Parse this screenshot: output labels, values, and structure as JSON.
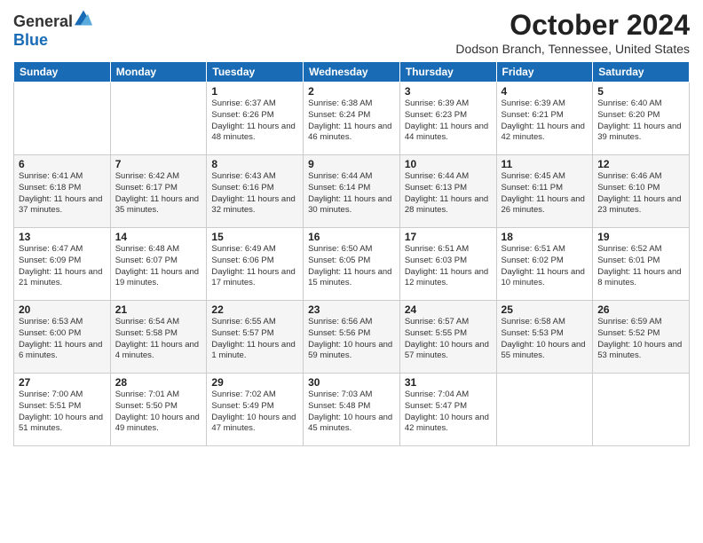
{
  "logo": {
    "general": "General",
    "blue": "Blue"
  },
  "title": "October 2024",
  "subtitle": "Dodson Branch, Tennessee, United States",
  "days_header": [
    "Sunday",
    "Monday",
    "Tuesday",
    "Wednesday",
    "Thursday",
    "Friday",
    "Saturday"
  ],
  "weeks": [
    [
      {
        "day": "",
        "detail": ""
      },
      {
        "day": "",
        "detail": ""
      },
      {
        "day": "1",
        "detail": "Sunrise: 6:37 AM\nSunset: 6:26 PM\nDaylight: 11 hours and 48 minutes."
      },
      {
        "day": "2",
        "detail": "Sunrise: 6:38 AM\nSunset: 6:24 PM\nDaylight: 11 hours and 46 minutes."
      },
      {
        "day": "3",
        "detail": "Sunrise: 6:39 AM\nSunset: 6:23 PM\nDaylight: 11 hours and 44 minutes."
      },
      {
        "day": "4",
        "detail": "Sunrise: 6:39 AM\nSunset: 6:21 PM\nDaylight: 11 hours and 42 minutes."
      },
      {
        "day": "5",
        "detail": "Sunrise: 6:40 AM\nSunset: 6:20 PM\nDaylight: 11 hours and 39 minutes."
      }
    ],
    [
      {
        "day": "6",
        "detail": "Sunrise: 6:41 AM\nSunset: 6:18 PM\nDaylight: 11 hours and 37 minutes."
      },
      {
        "day": "7",
        "detail": "Sunrise: 6:42 AM\nSunset: 6:17 PM\nDaylight: 11 hours and 35 minutes."
      },
      {
        "day": "8",
        "detail": "Sunrise: 6:43 AM\nSunset: 6:16 PM\nDaylight: 11 hours and 32 minutes."
      },
      {
        "day": "9",
        "detail": "Sunrise: 6:44 AM\nSunset: 6:14 PM\nDaylight: 11 hours and 30 minutes."
      },
      {
        "day": "10",
        "detail": "Sunrise: 6:44 AM\nSunset: 6:13 PM\nDaylight: 11 hours and 28 minutes."
      },
      {
        "day": "11",
        "detail": "Sunrise: 6:45 AM\nSunset: 6:11 PM\nDaylight: 11 hours and 26 minutes."
      },
      {
        "day": "12",
        "detail": "Sunrise: 6:46 AM\nSunset: 6:10 PM\nDaylight: 11 hours and 23 minutes."
      }
    ],
    [
      {
        "day": "13",
        "detail": "Sunrise: 6:47 AM\nSunset: 6:09 PM\nDaylight: 11 hours and 21 minutes."
      },
      {
        "day": "14",
        "detail": "Sunrise: 6:48 AM\nSunset: 6:07 PM\nDaylight: 11 hours and 19 minutes."
      },
      {
        "day": "15",
        "detail": "Sunrise: 6:49 AM\nSunset: 6:06 PM\nDaylight: 11 hours and 17 minutes."
      },
      {
        "day": "16",
        "detail": "Sunrise: 6:50 AM\nSunset: 6:05 PM\nDaylight: 11 hours and 15 minutes."
      },
      {
        "day": "17",
        "detail": "Sunrise: 6:51 AM\nSunset: 6:03 PM\nDaylight: 11 hours and 12 minutes."
      },
      {
        "day": "18",
        "detail": "Sunrise: 6:51 AM\nSunset: 6:02 PM\nDaylight: 11 hours and 10 minutes."
      },
      {
        "day": "19",
        "detail": "Sunrise: 6:52 AM\nSunset: 6:01 PM\nDaylight: 11 hours and 8 minutes."
      }
    ],
    [
      {
        "day": "20",
        "detail": "Sunrise: 6:53 AM\nSunset: 6:00 PM\nDaylight: 11 hours and 6 minutes."
      },
      {
        "day": "21",
        "detail": "Sunrise: 6:54 AM\nSunset: 5:58 PM\nDaylight: 11 hours and 4 minutes."
      },
      {
        "day": "22",
        "detail": "Sunrise: 6:55 AM\nSunset: 5:57 PM\nDaylight: 11 hours and 1 minute."
      },
      {
        "day": "23",
        "detail": "Sunrise: 6:56 AM\nSunset: 5:56 PM\nDaylight: 10 hours and 59 minutes."
      },
      {
        "day": "24",
        "detail": "Sunrise: 6:57 AM\nSunset: 5:55 PM\nDaylight: 10 hours and 57 minutes."
      },
      {
        "day": "25",
        "detail": "Sunrise: 6:58 AM\nSunset: 5:53 PM\nDaylight: 10 hours and 55 minutes."
      },
      {
        "day": "26",
        "detail": "Sunrise: 6:59 AM\nSunset: 5:52 PM\nDaylight: 10 hours and 53 minutes."
      }
    ],
    [
      {
        "day": "27",
        "detail": "Sunrise: 7:00 AM\nSunset: 5:51 PM\nDaylight: 10 hours and 51 minutes."
      },
      {
        "day": "28",
        "detail": "Sunrise: 7:01 AM\nSunset: 5:50 PM\nDaylight: 10 hours and 49 minutes."
      },
      {
        "day": "29",
        "detail": "Sunrise: 7:02 AM\nSunset: 5:49 PM\nDaylight: 10 hours and 47 minutes."
      },
      {
        "day": "30",
        "detail": "Sunrise: 7:03 AM\nSunset: 5:48 PM\nDaylight: 10 hours and 45 minutes."
      },
      {
        "day": "31",
        "detail": "Sunrise: 7:04 AM\nSunset: 5:47 PM\nDaylight: 10 hours and 42 minutes."
      },
      {
        "day": "",
        "detail": ""
      },
      {
        "day": "",
        "detail": ""
      }
    ]
  ]
}
